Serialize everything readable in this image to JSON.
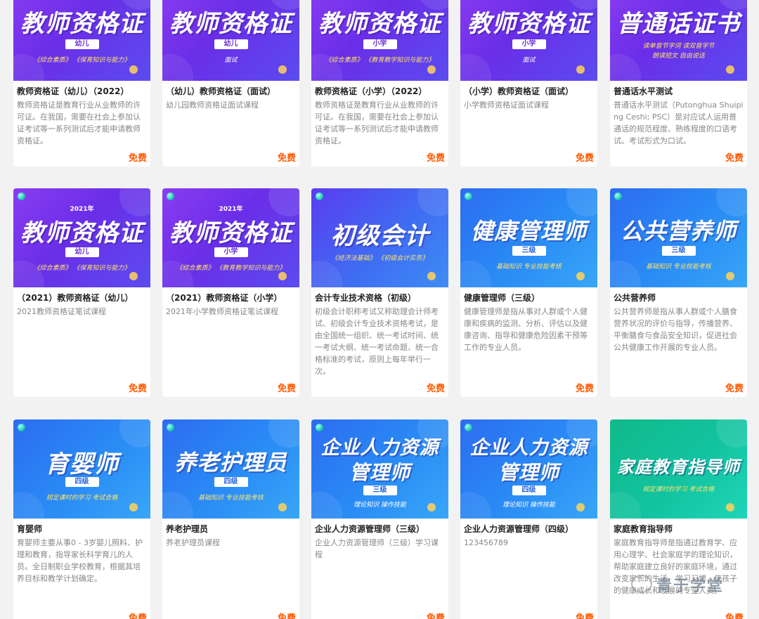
{
  "colors": {
    "price": "#ff5a00",
    "purple_banner": "#7a33ee",
    "blue_banner": "#2a80f2",
    "teal_banner": "#12c3a0"
  },
  "courses": [
    {
      "banner_main": "教师资格证",
      "banner_tag": "幼儿",
      "banner_sub": "《综合素质》 《保育知识与能力》",
      "title": "教师资格证（幼儿）（2022）",
      "desc": "教师资格证是教育行业从业教师的许可证。在我国，需要在社会上参加认证考试等一系列测试后才能申请教师资格证。",
      "price": "免费"
    },
    {
      "banner_main": "教师资格证",
      "banner_tag": "幼儿",
      "banner_sub": "面试",
      "title": "（幼儿）教师资格证（面试）",
      "desc": "幼儿园教师资格证面试课程",
      "price": "免费"
    },
    {
      "banner_main": "教师资格证",
      "banner_tag": "小学",
      "banner_sub": "《综合素质》 《教育教学知识与能力》",
      "title": "教师资格证（小学）（2022）",
      "desc": "教师资格证是教育行业从业教师的许可证。在我国，需要在社会上参加认证考试等一系列测试后才能申请教师资格证。",
      "price": "免费"
    },
    {
      "banner_main": "教师资格证",
      "banner_tag": "小学",
      "banner_sub": "面试",
      "title": "（小学）教师资格证（面试）",
      "desc": "小学教师资格证面试课程",
      "price": "免费"
    },
    {
      "banner_main": "普通话证书",
      "banner_sub": "读单音节字词  读双音字节",
      "banner_sub2": "朗读短文  自由说话",
      "title": "普通话水平测试",
      "desc": "普通话水平测试（Putonghua Shuiping Ceshi; PSC）是对应试人运用普通话的规范程度、熟练程度的口语考试。考试形式为口试。",
      "price": "免费"
    },
    {
      "banner_year": "2021年",
      "banner_main": "教师资格证",
      "banner_tag": "幼儿",
      "banner_sub": "《综合素质》 《保育知识与能力》",
      "title": "（2021）教师资格证（幼儿）",
      "desc": "2021教师资格证笔试课程",
      "price": "免费"
    },
    {
      "banner_year": "2021年",
      "banner_main": "教师资格证",
      "banner_tag": "小学",
      "banner_sub": "《综合素质》 《教育教学知识与能力》",
      "title": "（2021）教师资格证（小学）",
      "desc": "2021年小学教师资格证笔试课程",
      "price": "免费"
    },
    {
      "banner_main": "初级会计",
      "banner_sub": "《经济法基础》  《初级会计实务》",
      "title": "会计专业技术资格（初级）",
      "desc": "初级会计职称考试又称助理会计师考试、初级会计专业技术资格考试，是由全国统一组织、统一考试时间、统一考试大纲、统一考试命题、统一合格标准的考试，原则上每年举行一次。",
      "price": "免费"
    },
    {
      "banner_main": "健康管理师",
      "banner_tag": "三级",
      "banner_sub": "基础知识  专业技能考核",
      "title": "健康管理师（三级）",
      "desc": "健康管理师是指从事对人群或个人健康和疾病的监测、分析、评估以及健康咨询、指导和健康危险因素干预等工作的专业人员。",
      "price": "免费"
    },
    {
      "banner_main": "公共营养师",
      "banner_tag": "三级",
      "banner_sub": "基础知识  专业技能考核",
      "title": "公共营养师",
      "desc": "公共营养师是指从事人群或个人膳食营养状况的评价与指导，传播营养、平衡膳食与食品安全知识，促进社会公共健康工作开展的专业人员。",
      "price": "免费"
    },
    {
      "banner_main": "育婴师",
      "banner_tag": "四级",
      "banner_sub": "规定课时的学习  考试合格",
      "title": "育婴师",
      "desc": "育婴师主要从事0 - 3岁婴儿照料、护理和教育，指导家长科学育儿的人员。全日制职业学校教育，根据其培养目标和教学计划确定。",
      "price": "免费"
    },
    {
      "banner_main": "养老护理员",
      "banner_tag": "四级",
      "banner_sub": "基础知识  专业技能考核",
      "title": "养老护理员",
      "desc": "养老护理员课程",
      "price": "免费"
    },
    {
      "banner_main": "企业人力资源",
      "banner_main2": "管理师",
      "banner_tag": "三级",
      "banner_sub": "理论知识  操作技能",
      "title": "企业人力资源管理师（三级）",
      "desc": "企业人力资源管理师（三级）学习课程",
      "price": "免费"
    },
    {
      "banner_main": "企业人力资源",
      "banner_main2": "管理师",
      "banner_tag": "四级",
      "banner_sub": "理论知识  操作技能",
      "title": "企业人力资源管理师（四级）",
      "desc": "123456789",
      "price": "免费"
    },
    {
      "banner_main": "家庭教育指导师",
      "banner_sub": "规定课时的学习  考试合格",
      "title": "家庭教育指导师",
      "desc": "家庭教育指导师是指通过教育学、应用心理学、社会家庭学的理论知识，帮助家庭建立良好的家庭环境，通过改变家长的生活、学习习惯，使孩子的健康成长和发展的专业人员。",
      "price": "免费"
    }
  ],
  "watermark": {
    "text": "青于学堂"
  }
}
